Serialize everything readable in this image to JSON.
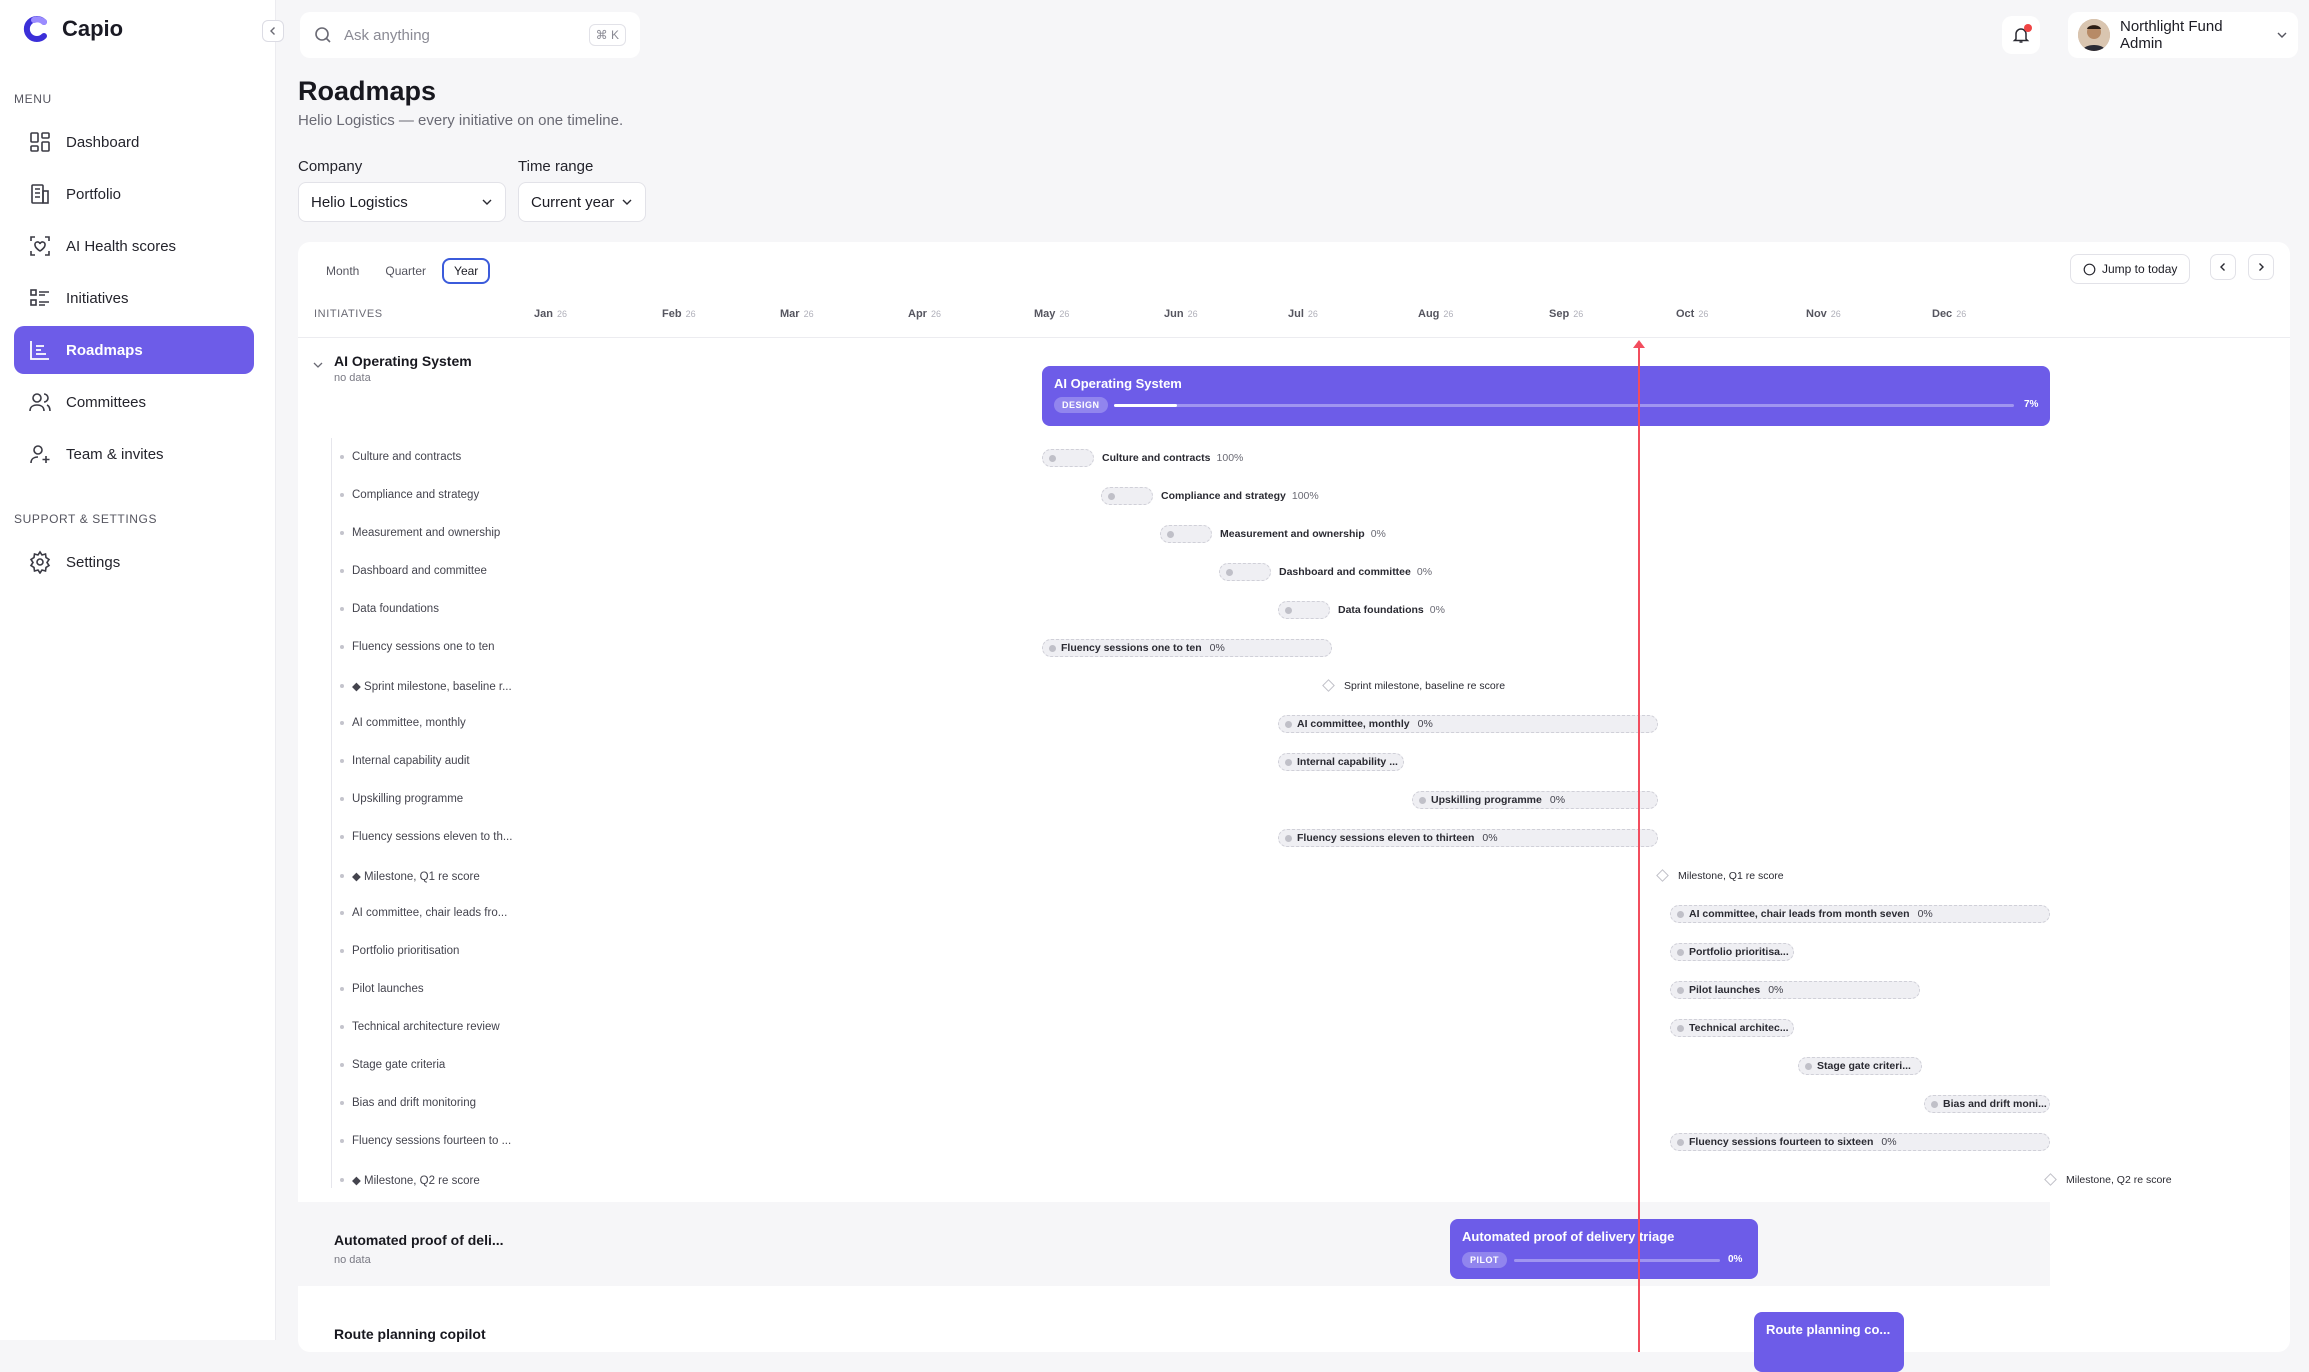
{
  "app": {
    "name": "Capio"
  },
  "sidebar": {
    "menu_heading": "MENU",
    "items": [
      {
        "label": "Dashboard",
        "icon": "dashboard-icon"
      },
      {
        "label": "Portfolio",
        "icon": "building-icon"
      },
      {
        "label": "AI Health scores",
        "icon": "health-icon"
      },
      {
        "label": "Initiatives",
        "icon": "list-icon"
      },
      {
        "label": "Roadmaps",
        "icon": "roadmap-icon",
        "active": true
      },
      {
        "label": "Committees",
        "icon": "users-icon"
      },
      {
        "label": "Team & invites",
        "icon": "user-plus-icon"
      }
    ],
    "support_heading": "SUPPORT & SETTINGS",
    "settings_label": "Settings"
  },
  "topbar": {
    "search_placeholder": "Ask anything",
    "shortcut": "⌘ K",
    "user_name": "Northlight Fund Admin"
  },
  "page": {
    "title": "Roadmaps",
    "subtitle": "Helio Logistics — every initiative on one timeline."
  },
  "filters": {
    "company_label": "Company",
    "company_value": "Helio Logistics",
    "range_label": "Time range",
    "range_value": "Current year"
  },
  "toolbar": {
    "views": [
      "Month",
      "Quarter",
      "Year"
    ],
    "active_view": "Year",
    "jump_label": "Jump to today"
  },
  "timeline": {
    "column_header": "INITIATIVES",
    "year_suffix": "26",
    "months": [
      "Jan",
      "Feb",
      "Mar",
      "Apr",
      "May",
      "Jun",
      "Jul",
      "Aug",
      "Sep",
      "Oct",
      "Nov",
      "Dec"
    ],
    "groups": [
      {
        "name": "AI Operating System",
        "sub": "no data",
        "bar_title": "AI Operating System",
        "phase": "DESIGN",
        "progress": 7,
        "progress_label": "7%",
        "tasks": [
          {
            "name": "Culture and contracts",
            "bar_label": "Culture and contracts",
            "pct": "100%"
          },
          {
            "name": "Compliance and strategy",
            "bar_label": "Compliance and strategy",
            "pct": "100%"
          },
          {
            "name": "Measurement and ownership",
            "bar_label": "Measurement and ownership",
            "pct": "0%"
          },
          {
            "name": "Dashboard and committee",
            "bar_label": "Dashboard and committee",
            "pct": "0%"
          },
          {
            "name": "Data foundations",
            "bar_label": "Data foundations",
            "pct": "0%"
          },
          {
            "name": "Fluency sessions one to ten",
            "bar_label": "Fluency sessions one to ten",
            "pct": "0%"
          },
          {
            "name": "◆ Sprint milestone, baseline r...",
            "bar_label": "Sprint milestone, baseline re score",
            "pct": ""
          },
          {
            "name": "AI committee, monthly",
            "bar_label": "AI committee, monthly",
            "pct": "0%"
          },
          {
            "name": "Internal capability audit",
            "bar_label": "Internal capability ...",
            "pct": ""
          },
          {
            "name": "Upskilling programme",
            "bar_label": "Upskilling programme",
            "pct": "0%"
          },
          {
            "name": "Fluency sessions eleven to th...",
            "bar_label": "Fluency sessions eleven to thirteen",
            "pct": "0%"
          },
          {
            "name": "◆ Milestone, Q1 re score",
            "bar_label": "Milestone, Q1 re score",
            "pct": ""
          },
          {
            "name": "AI committee, chair leads fro...",
            "bar_label": "AI committee, chair leads from month seven",
            "pct": "0%"
          },
          {
            "name": "Portfolio prioritisation",
            "bar_label": "Portfolio prioritisa...",
            "pct": ""
          },
          {
            "name": "Pilot launches",
            "bar_label": "Pilot launches",
            "pct": "0%"
          },
          {
            "name": "Technical architecture review",
            "bar_label": "Technical architec...",
            "pct": ""
          },
          {
            "name": "Stage gate criteria",
            "bar_label": "Stage gate criteri...",
            "pct": ""
          },
          {
            "name": "Bias and drift monitoring",
            "bar_label": "Bias and drift moni...",
            "pct": ""
          },
          {
            "name": "Fluency sessions fourteen to ...",
            "bar_label": "Fluency sessions fourteen to sixteen",
            "pct": "0%"
          },
          {
            "name": "◆ Milestone, Q2 re score",
            "bar_label": "Milestone, Q2 re score",
            "pct": ""
          }
        ]
      },
      {
        "name": "Automated proof of deli...",
        "sub": "no data",
        "bar_title": "Automated proof of delivery triage",
        "phase": "PILOT",
        "progress": 0,
        "progress_label": "0%"
      },
      {
        "name": "Route planning copilot",
        "bar_title": "Route planning co..."
      }
    ]
  },
  "colors": {
    "accent": "#6d5ce8",
    "today_line": "#f24d5e",
    "active_view_border": "#3b5bdb"
  }
}
